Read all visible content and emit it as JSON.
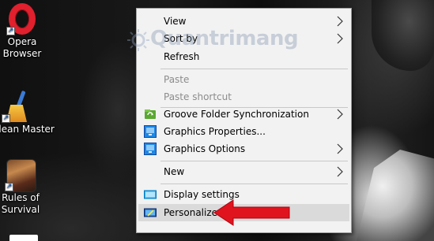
{
  "desktop": {
    "icons": [
      {
        "label_line1": "Opera",
        "label_line2": "Browser"
      },
      {
        "label_line1": "Clean Master",
        "label_line2": ""
      },
      {
        "label_line1": "Rules of",
        "label_line2": "Survival"
      }
    ]
  },
  "context_menu": {
    "items": [
      {
        "label": "View"
      },
      {
        "label": "Sort by"
      },
      {
        "label": "Refresh"
      },
      {
        "label": "Paste"
      },
      {
        "label": "Paste shortcut"
      },
      {
        "label": "Groove Folder Synchronization"
      },
      {
        "label": "Graphics Properties..."
      },
      {
        "label": "Graphics Options"
      },
      {
        "label": "New"
      },
      {
        "label": "Display settings"
      },
      {
        "label": "Personalize"
      }
    ]
  },
  "watermark": {
    "text": "Quantrimang"
  },
  "colors": {
    "menu_bg": "#f2f2f2",
    "menu_hover": "#dadada",
    "disabled_text": "#8c8c8c",
    "arrow_red": "#e0141e",
    "opera_red": "#e0202d"
  }
}
